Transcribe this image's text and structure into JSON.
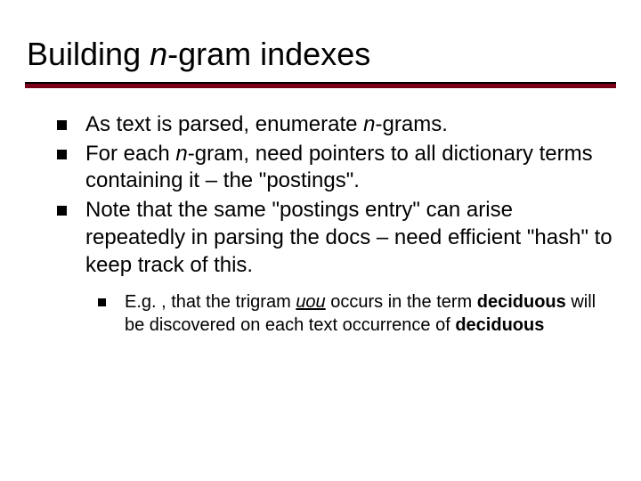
{
  "title_pre": "Building ",
  "title_ital": "n",
  "title_post": "-gram indexes",
  "bullets": {
    "b1_pre": "As text is parsed, enumerate ",
    "b1_ital": "n",
    "b1_post": "-grams.",
    "b2_pre": "For each ",
    "b2_ital": "n",
    "b2_post": "-gram, need pointers to all dictionary terms containing it – the \"postings\".",
    "b3": "Note that the same \"postings entry\" can arise repeatedly in parsing the docs – need efficient \"hash\" to keep track of this."
  },
  "sub": {
    "s1_a": "E.g. , that the trigram ",
    "s1_tri": "uou",
    "s1_b": " occurs in the term ",
    "s1_term1": "deciduous",
    "s1_c": " will be discovered on each text occurrence of ",
    "s1_term2": "deciduous"
  }
}
